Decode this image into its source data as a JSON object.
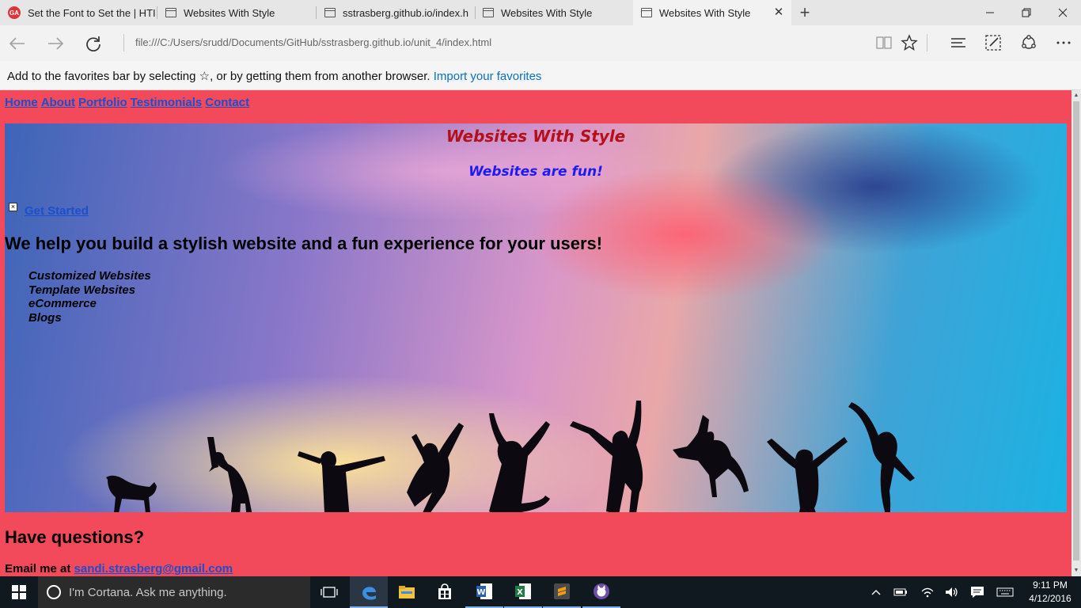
{
  "browser": {
    "tabs": [
      {
        "label": "Set the Font to Set the | HTI",
        "icon": "red-app-icon",
        "active": false
      },
      {
        "label": "Websites With Style",
        "icon": "page-icon",
        "active": false
      },
      {
        "label": "sstrasberg.github.io/index.h",
        "icon": "page-icon",
        "active": false
      },
      {
        "label": "Websites With Style",
        "icon": "page-icon",
        "active": false
      },
      {
        "label": "Websites With Style",
        "icon": "page-icon",
        "active": true
      }
    ],
    "address": "file:///C:/Users/srudd/Documents/GitHub/sstrasberg.github.io/unit_4/index.html",
    "favorites_bar": {
      "message": "Add to the favorites bar by selecting ☆, or by getting them from another browser. ",
      "link": "Import your favorites"
    }
  },
  "page": {
    "nav": [
      "Home",
      "About",
      "Portfolio",
      "Testimonials",
      "Contact"
    ],
    "hero_title": "Websites With Style",
    "hero_subtitle": "Websites are fun!",
    "cta": "Get Started",
    "tagline": "We help you build a stylish website and a fun experience for your users!",
    "services": [
      "Customized Websites",
      "Template Websites",
      "eCommerce",
      "Blogs"
    ],
    "questions_heading": "Have questions?",
    "email_prefix": "Email me at ",
    "email": "sandi.strasberg@gmail.com",
    "background_color": "#f24a5a",
    "link_color": "#1a4fd0"
  },
  "taskbar": {
    "cortana_placeholder": "I'm Cortana. Ask me anything.",
    "time": "9:11 PM",
    "date": "4/12/2016"
  }
}
